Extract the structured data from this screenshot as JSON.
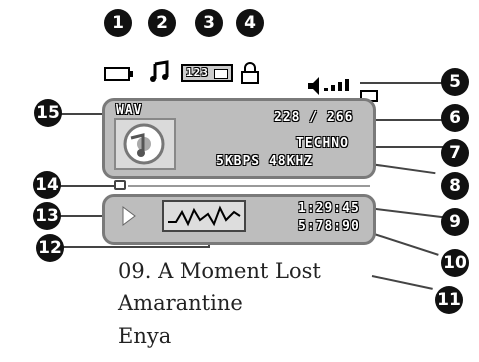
{
  "callouts": [
    "1",
    "2",
    "3",
    "4",
    "5",
    "6",
    "7",
    "8",
    "9",
    "10",
    "11",
    "12",
    "13",
    "14",
    "15"
  ],
  "status_bar": {
    "repeat_label": "123",
    "icons": [
      "battery-icon",
      "music-note-icon",
      "repeat-mode-icon",
      "lock-icon",
      "volume-icon"
    ]
  },
  "info_panel": {
    "format": "WAV",
    "track_count": "228 / 266",
    "genre": "TECHNO",
    "bitrate": "5KBPS 48KHZ"
  },
  "playback_panel": {
    "elapsed": "1:29:45",
    "total": "5:78:90"
  },
  "track": {
    "title": "09. A Moment Lost",
    "album": "Amarantine",
    "artist": "Enya"
  },
  "colors": {
    "panel": "#bdbdbd",
    "panel_border": "#7a7a7a",
    "callout_bg": "#111111"
  }
}
